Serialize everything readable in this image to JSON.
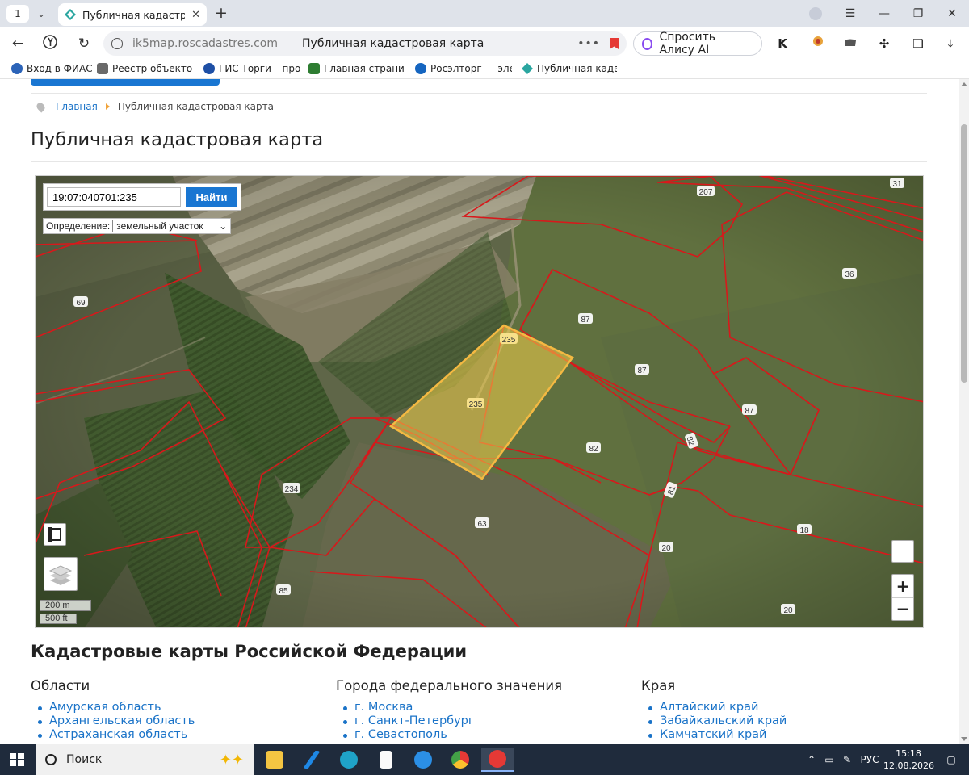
{
  "browser": {
    "tab_count": "1",
    "active_tab_title": "Публичная кадастровая карта",
    "url_domain": "ik5map.roscadastres.com",
    "page_title": "Публичная кадастровая карта",
    "alice_label": "Спросить Алису AI",
    "bookmarks": [
      {
        "label": "Вход в ФИАС",
        "icon": "fias-icon"
      },
      {
        "label": "Реестр объектов",
        "icon": "registry-icon"
      },
      {
        "label": "ГИС Торги – прод",
        "icon": "gis-torgi-icon"
      },
      {
        "label": "Главная страница",
        "icon": "emblem-icon"
      },
      {
        "label": "Росэлторг — элек",
        "icon": "roseltorg-icon"
      },
      {
        "label": "Публичная кадас",
        "icon": "cadastre-icon"
      }
    ]
  },
  "breadcrumb": {
    "home": "Главная",
    "current": "Публичная кадастровая карта"
  },
  "page": {
    "title": "Публичная кадастровая карта"
  },
  "map": {
    "search_value": "19:07:040701:235",
    "search_button": "Найти",
    "definition_label": "Определение:",
    "definition_value": "земельный участок",
    "scale_metric": "200 m",
    "scale_imperial": "500 ft",
    "zoom_in": "+",
    "zoom_out": "−",
    "highlight_color": "#f2d04a",
    "border_color": "#d8181b",
    "parcel_labels": [
      "207",
      "31",
      "36",
      "69",
      "87",
      "87",
      "87",
      "235",
      "235",
      "82",
      "82",
      "234",
      "81",
      "63",
      "18",
      "20",
      "85",
      "20"
    ]
  },
  "directory": {
    "title": "Кадастровые карты Российской Федерации",
    "columns": [
      {
        "heading": "Области",
        "items": [
          "Амурская область",
          "Архангельская область",
          "Астраханская область"
        ]
      },
      {
        "heading": "Города федерального значения",
        "items": [
          "г. Москва",
          "г. Санкт-Петербург",
          "г. Севастополь"
        ]
      },
      {
        "heading": "Края",
        "items": [
          "Алтайский край",
          "Забайкальский край",
          "Камчатский край"
        ]
      }
    ]
  },
  "taskbar": {
    "search_label": "Поиск",
    "language": "РУС",
    "time": "15:18",
    "date": "12.08.2026"
  }
}
